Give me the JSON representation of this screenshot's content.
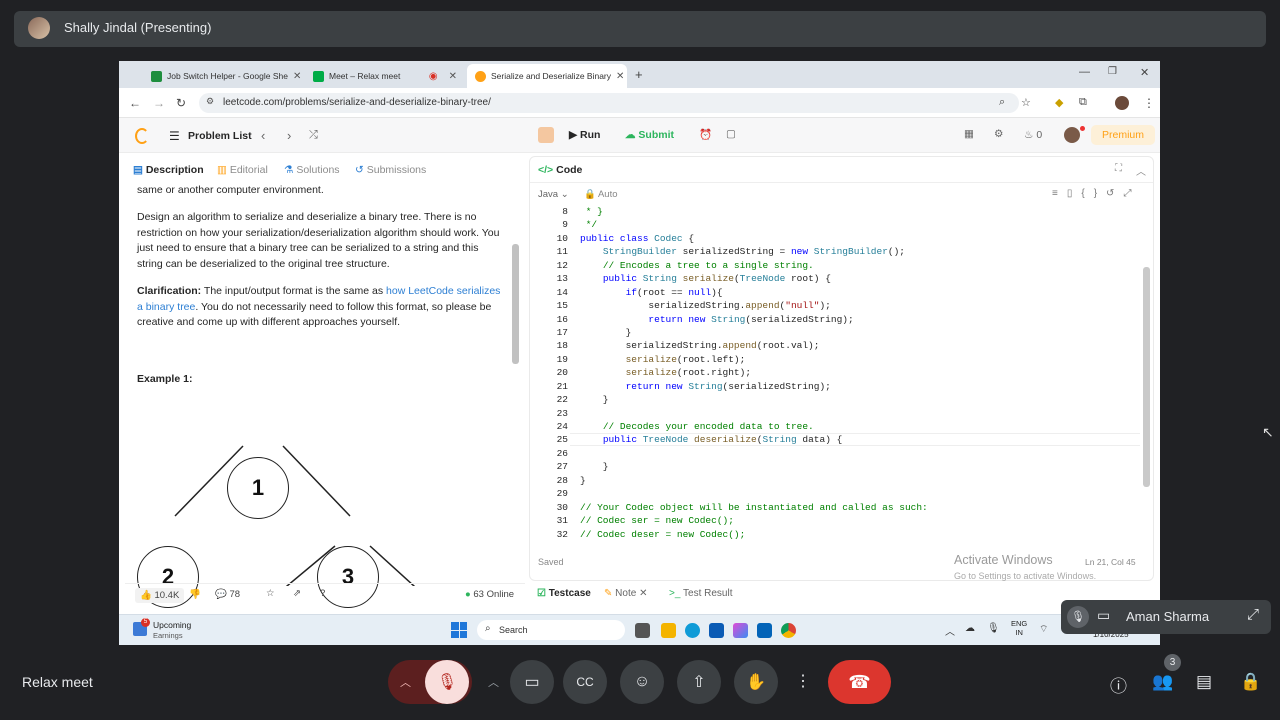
{
  "meet": {
    "presenter": "Shally Jindal (Presenting)",
    "meeting_name": "Relax meet",
    "self_name": "Aman Sharma",
    "participants_badge": "3"
  },
  "browser": {
    "tabs": [
      {
        "title": "Job Switch Helper - Google She",
        "fav": "#1e8e3e"
      },
      {
        "title": "Meet – Relax meet",
        "fav": "#00ac47"
      },
      {
        "title": "Serialize and Deserialize Binary",
        "fav": "#ffa116"
      }
    ],
    "url": "leetcode.com/problems/serialize-and-deserialize-binary-tree/"
  },
  "leetcode": {
    "problem_list": "Problem List",
    "run": "Run",
    "submit": "Submit",
    "fire_count": "0",
    "premium": "Premium",
    "left_tabs": {
      "description": "Description",
      "editorial": "Editorial",
      "solutions": "Solutions",
      "submissions": "Submissions"
    },
    "desc_top": "same or another computer environment.",
    "para1": "Design an algorithm to serialize and deserialize a binary tree. There is no restriction on how your serialization/deserialization algorithm should work. You just need to ensure that a binary tree can be serialized to a string and this string can be deserialized to the original tree structure.",
    "clar_label": "Clarification:",
    "clar_text": " The input/output format is the same as ",
    "clar_link": "how LeetCode serializes a binary tree",
    "clar_rest": ". You do not necessarily need to follow this format, so please be creative and come up with different approaches yourself.",
    "example1": "Example 1:",
    "tree_nodes": [
      "1",
      "2",
      "3"
    ],
    "likes": "10.4K",
    "comments": "78",
    "online": "63 Online",
    "code_tab": "Code",
    "language": "Java",
    "auto": "Auto",
    "saved": "Saved",
    "cursor_pos": "Ln 21, Col 45",
    "bottom_tabs": {
      "testcase": "Testcase",
      "note": "Note",
      "result": "Test Result"
    },
    "activate": "Activate Windows",
    "activate_sub": "Go to Settings to activate Windows."
  },
  "code_lines": [
    {
      "n": "8",
      "h": "<span class=\"cm\"> * }</span>"
    },
    {
      "n": "9",
      "h": "<span class=\"cm\"> */</span>"
    },
    {
      "n": "10",
      "h": "<span class=\"kw\">public class</span> <span class=\"ty\">Codec</span> {"
    },
    {
      "n": "11",
      "h": "    <span class=\"ty\">StringBuilder</span> serializedString = <span class=\"kw\">new</span> <span class=\"ty\">StringBuilder</span>();"
    },
    {
      "n": "12",
      "h": "    <span class=\"cm\">// Encodes a tree to a single string.</span>"
    },
    {
      "n": "13",
      "h": "    <span class=\"kw\">public</span> <span class=\"ty\">String</span> <span class=\"fn\">serialize</span>(<span class=\"ty\">TreeNode</span> root) {"
    },
    {
      "n": "14",
      "h": "        <span class=\"kw\">if</span>(root == <span class=\"kw\">null</span>){"
    },
    {
      "n": "15",
      "h": "            serializedString.<span class=\"fn\">append</span>(<span class=\"st\">\"null\"</span>);"
    },
    {
      "n": "16",
      "h": "            <span class=\"kw\">return new</span> <span class=\"ty\">String</span>(serializedString);"
    },
    {
      "n": "17",
      "h": "        }"
    },
    {
      "n": "18",
      "h": "        serializedString.<span class=\"fn\">append</span>(root.val);"
    },
    {
      "n": "19",
      "h": "        <span class=\"fn\">serialize</span>(root.left);"
    },
    {
      "n": "20",
      "h": "        <span class=\"fn\">serialize</span>(root.right);"
    },
    {
      "n": "21",
      "h": "        <span class=\"kw\">return new</span> <span class=\"ty\">String</span>(serializedString);"
    },
    {
      "n": "22",
      "h": "    }"
    },
    {
      "n": "23",
      "h": ""
    },
    {
      "n": "24",
      "h": "    <span class=\"cm\">// Decodes your encoded data to tree.</span>"
    },
    {
      "n": "25",
      "h": "    <span class=\"kw\">public</span> <span class=\"ty\">TreeNode</span> <span class=\"fn\">deserialize</span>(<span class=\"ty\">String</span> data) {"
    },
    {
      "n": "26",
      "h": ""
    },
    {
      "n": "27",
      "h": "    }"
    },
    {
      "n": "28",
      "h": "}"
    },
    {
      "n": "29",
      "h": ""
    },
    {
      "n": "30",
      "h": "<span class=\"cm\">// Your Codec object will be instantiated and called as such:</span>"
    },
    {
      "n": "31",
      "h": "<span class=\"cm\">// Codec ser = new Codec();</span>"
    },
    {
      "n": "32",
      "h": "<span class=\"cm\">// Codec deser = new Codec();</span>"
    }
  ],
  "taskbar": {
    "upcoming": "Upcoming",
    "earnings": "Earnings",
    "search": "Search",
    "lang1": "ENG",
    "lang2": "IN",
    "date": "1/10/2025",
    "notif": "5"
  }
}
